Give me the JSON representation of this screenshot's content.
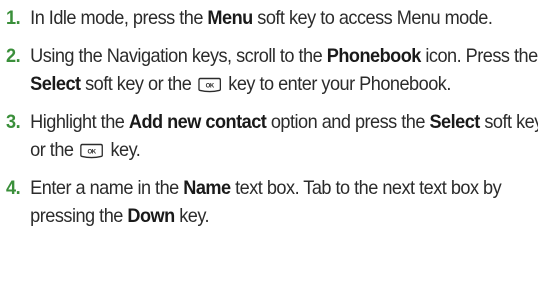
{
  "steps": [
    {
      "number": "1.",
      "parts": [
        {
          "text": "In Idle mode, press the "
        },
        {
          "text": "Menu",
          "bold": true
        },
        {
          "text": " soft key to access Menu mode."
        }
      ]
    },
    {
      "number": "2.",
      "parts": [
        {
          "text": "Using the Navigation keys, scroll to the "
        },
        {
          "text": "Phonebook",
          "bold": true
        },
        {
          "text": " icon. Press the "
        },
        {
          "text": "Select",
          "bold": true
        },
        {
          "text": " soft key or the "
        },
        {
          "icon": "ok-key-icon",
          "label": "OK"
        },
        {
          "text": " key to enter your Phonebook."
        }
      ]
    },
    {
      "number": "3.",
      "parts": [
        {
          "text": "Highlight the "
        },
        {
          "text": "Add new contact",
          "bold": true
        },
        {
          "text": " option and press the "
        },
        {
          "text": "Select",
          "bold": true
        },
        {
          "text": " soft key or the "
        },
        {
          "icon": "ok-key-icon",
          "label": "OK"
        },
        {
          "text": " key."
        }
      ]
    },
    {
      "number": "4.",
      "parts": [
        {
          "text": "Enter a name in the "
        },
        {
          "text": "Name",
          "bold": true
        },
        {
          "text": " text box. Tab to the next text box by pressing the "
        },
        {
          "text": "Down",
          "bold": true
        },
        {
          "text": " key."
        }
      ]
    }
  ],
  "colors": {
    "step_number": "#3a8f3a",
    "body_text": "#2b2b2b",
    "bold_text": "#1a1a1a"
  }
}
